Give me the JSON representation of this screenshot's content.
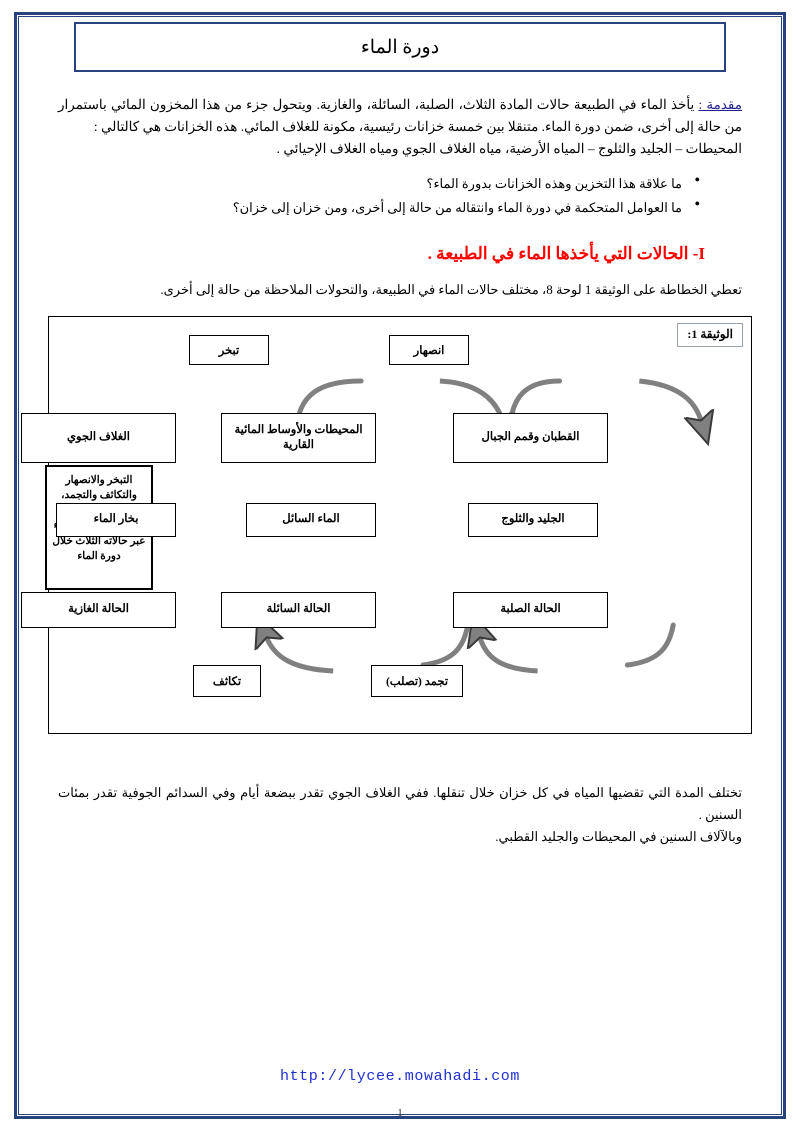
{
  "document": {
    "title": "دورة الماء",
    "page_number": "1",
    "footer_url": "http://lycee.mowahadi.com"
  },
  "intro": {
    "lead_label": "مقدمة :",
    "paragraph": " يأخذ الماء في الطبيعة حالات المادة الثلاث، الصلبة، السائلة، والغازية. ويتحول جزء من هذا المخزون المائي باستمرار من حالة إلى أخرى، ضمن دورة الماء. متنقلا بين خمسة خزانات رئيسية، مكونة للغلاف المائي. هذه الخزانات هي كالتالي :",
    "reservoirs_line": "المحيطات – الجليد والثلوج – المياه الأرضية، مياه الغلاف الجوي ومياه الغلاف الإحيائي ."
  },
  "questions": [
    "ما علاقة هذا التخزين وهذه الخزانات بدورة الماء؟",
    "ما العوامل المتحكمة في دورة الماء وانتقاله من حالة إلى أخرى، ومن خزان إلى خزان؟"
  ],
  "section": {
    "number": "I-",
    "heading": "الحالات التي يأخذها الماء في الطبيعة .",
    "color": "#ff0000",
    "sub_line": "تعطي الخطاطة على الوثيقة 1 لوحة 8، مختلف حالات الماء في الطبيعة، والتحولات الملاحظة من حالة إلى أخرى."
  },
  "diagram": {
    "doc_label": "الوثيقة 1:",
    "side_note": "التبخر والانصهار والتكاثف والتجمد، ظواهر فيزيائية، تتدخل في تحول الماء عبر حالاته الثلاث خلال دورة الماء",
    "process_top": [
      {
        "label": "انصهار"
      },
      {
        "label": "تبخر"
      }
    ],
    "reservoirs": [
      {
        "label": "القطبان وقمم الجبال"
      },
      {
        "label": "المحيطات والأوساط المائية القارية"
      },
      {
        "label": "الغلاف الجوي"
      }
    ],
    "forms": [
      {
        "label": "الجليد والثلوج"
      },
      {
        "label": "الماء السائل"
      },
      {
        "label": "بخار الماء"
      }
    ],
    "states": [
      {
        "label": "الحالة الصلبة"
      },
      {
        "label": "الحالة السائلة"
      },
      {
        "label": "الحالة الغازية"
      }
    ],
    "process_bottom": [
      {
        "label": "تجمد (تصلب)"
      },
      {
        "label": "تكاثف"
      }
    ],
    "arrow_color": "#808080"
  },
  "tail": {
    "line1": "تختلف المدة التي تقضيها المياه في كل خزان خلال تنقلها. ففي الغلاف الجوي تقدر ببضعة أيام وفي السدائم الجوفية تقدر بمئات السنين .",
    "line2": "وبالآلاف السنين في المحيطات والجليد القطبي."
  }
}
